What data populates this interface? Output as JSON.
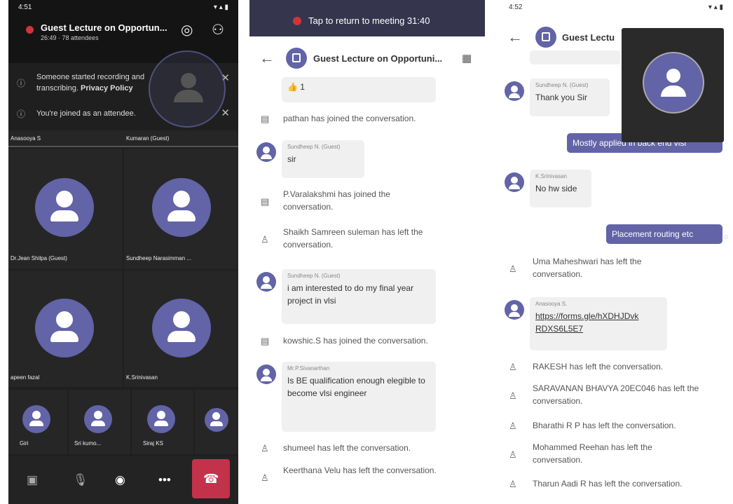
{
  "screen1": {
    "status_time": "4:51",
    "meeting_title": "Guest Lecture on Opportun...",
    "meeting_sub": "26:49 · 78 attendees",
    "notice_recording": "Someone started recording and transcribing.",
    "notice_privacy": "Privacy Policy",
    "notice_joined": "You're joined as an attendee.",
    "tiles": [
      {
        "name": "Anasooya S"
      },
      {
        "name": "Kumaran (Guest)"
      },
      {
        "name": "Dr.Jean Shilpa (Guest)"
      },
      {
        "name": "Sundheep Narasimman ..."
      },
      {
        "name": "apeen fazal"
      },
      {
        "name": "K.Srinivasan"
      }
    ],
    "small_tiles": [
      {
        "name": "Giri"
      },
      {
        "name": "Sri kumo..."
      },
      {
        "name": "Siraj KS"
      }
    ],
    "controls": {
      "video_icon": "video-off-icon",
      "mic_icon": "mic-off-icon",
      "audio_icon": "headset-icon",
      "more_icon": "more-icon",
      "more_label": "•••",
      "end_icon": "hang-up-icon"
    }
  },
  "screen2": {
    "return_banner": "Tap to return to meeting 31:40",
    "chat_title": "Guest Lecture on Opportuni...",
    "reaction": "👍 1",
    "messages": [
      {
        "type": "system",
        "text": "pathan has joined the conversation."
      },
      {
        "type": "message",
        "sender": "Sundheep N. (Guest)",
        "text": "sir"
      },
      {
        "type": "system",
        "text": "P.Varalakshmi has joined the conversation."
      },
      {
        "type": "system",
        "text": "Shaikh Samreen suleman has left the conversation."
      },
      {
        "type": "message",
        "sender": "Sundheep N. (Guest)",
        "text": "i am interested to do my final year project in vlsi"
      },
      {
        "type": "system",
        "text": "kowshic.S has joined the conversation."
      },
      {
        "type": "message",
        "sender": "Mr.P.Sivanarthan",
        "text": "Is BE qualification enough elegible to become vlsi engineer"
      },
      {
        "type": "system",
        "text": "shumeel has left the conversation."
      },
      {
        "type": "system",
        "text": "Keerthana Velu has left the conversation."
      }
    ]
  },
  "screen3": {
    "status_time": "4:52",
    "chat_title": "Guest Lectu",
    "messages": [
      {
        "type": "message",
        "sender": "Sundheep N. (Guest)",
        "text": "Thank you Sir"
      },
      {
        "type": "own",
        "text": "Mostly applied in back end vlsi"
      },
      {
        "type": "message",
        "sender": "K.Srinivasan",
        "text": "No hw side"
      },
      {
        "type": "own",
        "text": "Placement routing etc"
      },
      {
        "type": "system",
        "text": "Uma Maheshwari has left the conversation."
      },
      {
        "type": "message",
        "sender": "Anasooya S.",
        "text": "https://forms.gle/hXDHJDvkRDXS6L5E7"
      },
      {
        "type": "system",
        "text": "RAKESH has left the conversation."
      },
      {
        "type": "system",
        "text": "SARAVANAN BHAVYA 20EC046 has left the conversation."
      },
      {
        "type": "system",
        "text": "Bharathi R P has left the conversation."
      },
      {
        "type": "system",
        "text": "Mohammed Reehan has left the conversation."
      },
      {
        "type": "system",
        "text": "Tharun Aadi R has left the conversation."
      }
    ]
  },
  "colors": {
    "accent": "#6264a7",
    "end_call": "#c4314b",
    "recording": "#d13438",
    "dark_bg": "#1f1f1f"
  }
}
